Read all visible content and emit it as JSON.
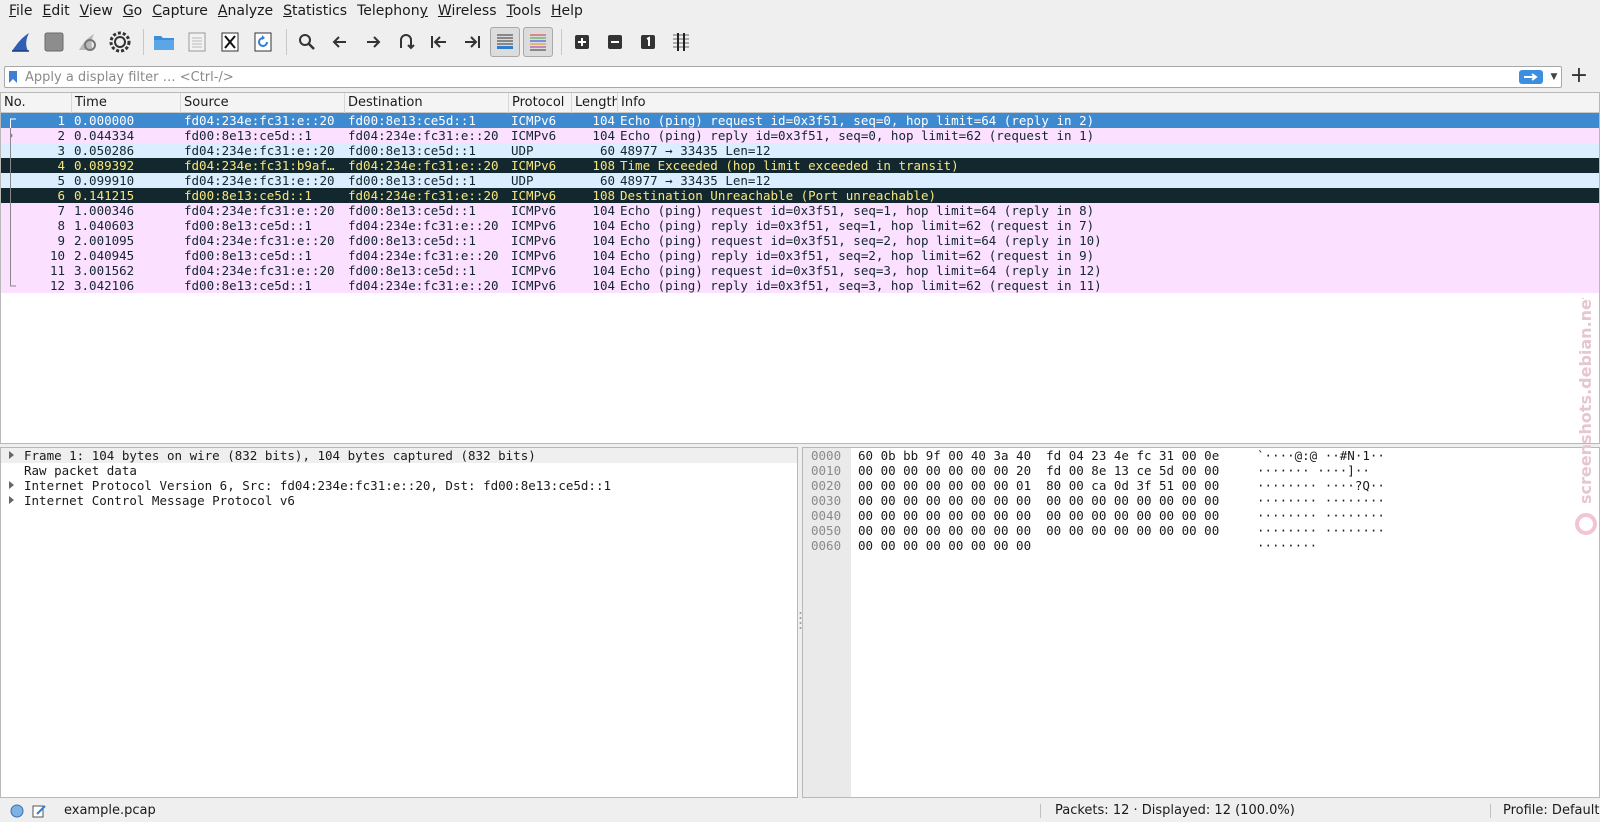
{
  "menu": {
    "items": [
      {
        "mnemonic": "F",
        "rest": "ile"
      },
      {
        "mnemonic": "E",
        "rest": "dit"
      },
      {
        "mnemonic": "V",
        "rest": "iew"
      },
      {
        "mnemonic": "G",
        "rest": "o"
      },
      {
        "mnemonic": "C",
        "rest": "apture"
      },
      {
        "mnemonic": "A",
        "rest": "nalyze"
      },
      {
        "mnemonic": "S",
        "rest": "tatistics"
      },
      {
        "mnemonic": "",
        "rest": "Telephon",
        "suffix_mnemonic": "y"
      },
      {
        "mnemonic": "W",
        "rest": "ireless"
      },
      {
        "mnemonic": "T",
        "rest": "ools"
      },
      {
        "mnemonic": "H",
        "rest": "elp"
      }
    ]
  },
  "toolbar": {
    "icons": [
      "start-capture-icon",
      "stop-capture-icon",
      "restart-capture-icon",
      "capture-options-icon",
      "open-file-icon",
      "save-file-icon",
      "close-file-icon",
      "reload-file-icon",
      "find-packet-icon",
      "go-back-icon",
      "go-forward-icon",
      "go-to-packet-icon",
      "go-first-icon",
      "go-last-icon",
      "autoscroll-icon",
      "colorize-icon",
      "zoom-in-icon",
      "zoom-out-icon",
      "normal-size-icon",
      "resize-columns-icon"
    ]
  },
  "filter": {
    "placeholder": "Apply a display filter … <Ctrl-/>",
    "value": ""
  },
  "packet_list": {
    "columns": [
      "No.",
      "Time",
      "Source",
      "Destination",
      "Protocol",
      "Length",
      "Info"
    ],
    "rows": [
      {
        "no": "1",
        "time": "0.000000",
        "src": "fd04:234e:fc31:e::20",
        "dst": "fd00:8e13:ce5d::1",
        "proto": "ICMPv6",
        "len": "104",
        "info": "Echo (ping) request id=0x3f51, seq=0, hop limit=64 (reply in 2)",
        "kind": "sel"
      },
      {
        "no": "2",
        "time": "0.044334",
        "src": "fd00:8e13:ce5d::1",
        "dst": "fd04:234e:fc31:e::20",
        "proto": "ICMPv6",
        "len": "104",
        "info": "Echo (ping) reply id=0x3f51, seq=0, hop limit=62 (request in 1)",
        "kind": "icmp"
      },
      {
        "no": "3",
        "time": "0.050286",
        "src": "fd04:234e:fc31:e::20",
        "dst": "fd00:8e13:ce5d::1",
        "proto": "UDP",
        "len": "60",
        "info": "48977 → 33435 Len=12",
        "kind": "udp"
      },
      {
        "no": "4",
        "time": "0.089392",
        "src": "fd04:234e:fc31:b9af…",
        "dst": "fd04:234e:fc31:e::20",
        "proto": "ICMPv6",
        "len": "108",
        "info": "Time Exceeded (hop limit exceeded in transit)",
        "kind": "err"
      },
      {
        "no": "5",
        "time": "0.099910",
        "src": "fd04:234e:fc31:e::20",
        "dst": "fd00:8e13:ce5d::1",
        "proto": "UDP",
        "len": "60",
        "info": "48977 → 33435 Len=12",
        "kind": "udp"
      },
      {
        "no": "6",
        "time": "0.141215",
        "src": "fd00:8e13:ce5d::1",
        "dst": "fd04:234e:fc31:e::20",
        "proto": "ICMPv6",
        "len": "108",
        "info": "Destination Unreachable (Port unreachable)",
        "kind": "err"
      },
      {
        "no": "7",
        "time": "1.000346",
        "src": "fd04:234e:fc31:e::20",
        "dst": "fd00:8e13:ce5d::1",
        "proto": "ICMPv6",
        "len": "104",
        "info": "Echo (ping) request id=0x3f51, seq=1, hop limit=64 (reply in 8)",
        "kind": "icmp"
      },
      {
        "no": "8",
        "time": "1.040603",
        "src": "fd00:8e13:ce5d::1",
        "dst": "fd04:234e:fc31:e::20",
        "proto": "ICMPv6",
        "len": "104",
        "info": "Echo (ping) reply id=0x3f51, seq=1, hop limit=62 (request in 7)",
        "kind": "icmp"
      },
      {
        "no": "9",
        "time": "2.001095",
        "src": "fd04:234e:fc31:e::20",
        "dst": "fd00:8e13:ce5d::1",
        "proto": "ICMPv6",
        "len": "104",
        "info": "Echo (ping) request id=0x3f51, seq=2, hop limit=64 (reply in 10)",
        "kind": "icmp"
      },
      {
        "no": "10",
        "time": "2.040945",
        "src": "fd00:8e13:ce5d::1",
        "dst": "fd04:234e:fc31:e::20",
        "proto": "ICMPv6",
        "len": "104",
        "info": "Echo (ping) reply id=0x3f51, seq=2, hop limit=62 (request in 9)",
        "kind": "icmp"
      },
      {
        "no": "11",
        "time": "3.001562",
        "src": "fd04:234e:fc31:e::20",
        "dst": "fd00:8e13:ce5d::1",
        "proto": "ICMPv6",
        "len": "104",
        "info": "Echo (ping) request id=0x3f51, seq=3, hop limit=64 (reply in 12)",
        "kind": "icmp"
      },
      {
        "no": "12",
        "time": "3.042106",
        "src": "fd00:8e13:ce5d::1",
        "dst": "fd04:234e:fc31:e::20",
        "proto": "ICMPv6",
        "len": "104",
        "info": "Echo (ping) reply id=0x3f51, seq=3, hop limit=62 (request in 11)",
        "kind": "icmp"
      }
    ]
  },
  "details": [
    {
      "text": "Frame 1: 104 bytes on wire (832 bits), 104 bytes captured (832 bits)",
      "expandable": true
    },
    {
      "text": "Raw packet data",
      "expandable": false
    },
    {
      "text": "Internet Protocol Version 6, Src: fd04:234e:fc31:e::20, Dst: fd00:8e13:ce5d::1",
      "expandable": true
    },
    {
      "text": "Internet Control Message Protocol v6",
      "expandable": true
    }
  ],
  "bytes": [
    {
      "offset": "0000",
      "hex": "60 0b bb 9f 00 40 3a 40  fd 04 23 4e fc 31 00 0e",
      "ascii": "`····@:@ ··#N·1··"
    },
    {
      "offset": "0010",
      "hex": "00 00 00 00 00 00 00 20  fd 00 8e 13 ce 5d 00 00",
      "ascii": "······· ····]··"
    },
    {
      "offset": "0020",
      "hex": "00 00 00 00 00 00 00 01  80 00 ca 0d 3f 51 00 00",
      "ascii": "········ ····?Q··"
    },
    {
      "offset": "0030",
      "hex": "00 00 00 00 00 00 00 00  00 00 00 00 00 00 00 00",
      "ascii": "········ ········"
    },
    {
      "offset": "0040",
      "hex": "00 00 00 00 00 00 00 00  00 00 00 00 00 00 00 00",
      "ascii": "········ ········"
    },
    {
      "offset": "0050",
      "hex": "00 00 00 00 00 00 00 00  00 00 00 00 00 00 00 00",
      "ascii": "········ ········"
    },
    {
      "offset": "0060",
      "hex": "00 00 00 00 00 00 00 00",
      "ascii": "········"
    }
  ],
  "watermark": "screenshots.debian.net",
  "status": {
    "file": "example.pcap",
    "packets": "Packets: 12 · Displayed: 12 (100.0%)",
    "profile": "Profile: Default"
  },
  "colors": {
    "selected_row": "#3d8ad0",
    "icmp_row": "#fce0ff",
    "udp_row": "#daeeff",
    "error_row": "#12272e",
    "error_text": "#f7e77b"
  }
}
